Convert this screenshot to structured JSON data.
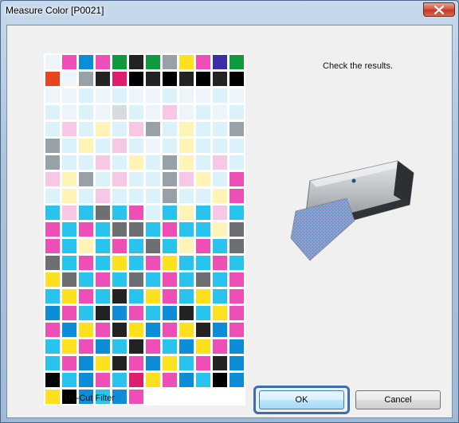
{
  "window": {
    "title": "Measure Color [P0021]"
  },
  "instruction": "Check the results.",
  "filter_label": "UV-Cut Filter",
  "buttons": {
    "ok": "OK",
    "cancel": "Cancel"
  },
  "colors": {
    "W": "#ffffff",
    "w": "#eef5fa",
    "c": "#dcf2fb",
    "C": "#29c4ee",
    "m": "#f7c8e6",
    "M": "#ee4fb6",
    "y": "#fff3b5",
    "Y": "#fde11f",
    "k": "#b5b8bb",
    "g": "#6d6f72",
    "K": "#232323",
    "B": "#000000",
    "U": "#0d8dd8",
    "G": "#0e9a3d",
    "V": "#3b2ea6",
    "R": "#de1f6e",
    "O": "#e8451e",
    "l": "#d6dbe0",
    "s": "#99a1a8",
    "p": "#f9a9d6",
    "a": "#7fd6f2"
  },
  "patch_rows": [
    "wMUMGKGsYMVG",
    "OwsKRBKBKBKB",
    "wwcwcwwcwwcw",
    "cwcwlcwmwcwc",
    "cmcycmscyccs",
    "scycmcwcyccc",
    "sccmcycsycmc",
    "myscmccsmycM",
    "cycmcccsccyM",
    "CmCgCMcCyCmC",
    "MCMCggCMCCyg",
    "MCyCMCgCyMCg",
    "gCMCYCMYCCMC",
    "YgCMCgCMCgCM",
    "CYMCKCYMCYCM",
    "UMCKUMCUKCYM",
    "MUYMKYUMYKUM",
    "CYMUCKMCUYMU",
    "CMUYKMUYCMKU",
    "BCUMCRYMUCBU",
    "YBUCUMWWWWWW"
  ]
}
